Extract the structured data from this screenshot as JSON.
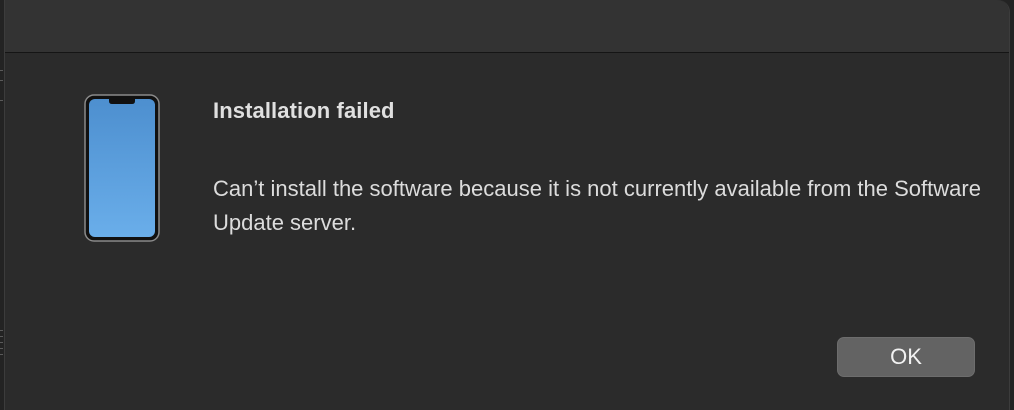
{
  "dialog": {
    "title": "Installation failed",
    "message": "Can’t install the software because it is not currently available from the Software Update server.",
    "icon": "iphone-icon"
  },
  "buttons": {
    "ok_label": "OK"
  },
  "colors": {
    "dialog_background": "#2b2b2b",
    "title_bar": "#333333",
    "button": "#636363",
    "screen_top": "#4d8fcf",
    "screen_bottom": "#6aaeea"
  }
}
